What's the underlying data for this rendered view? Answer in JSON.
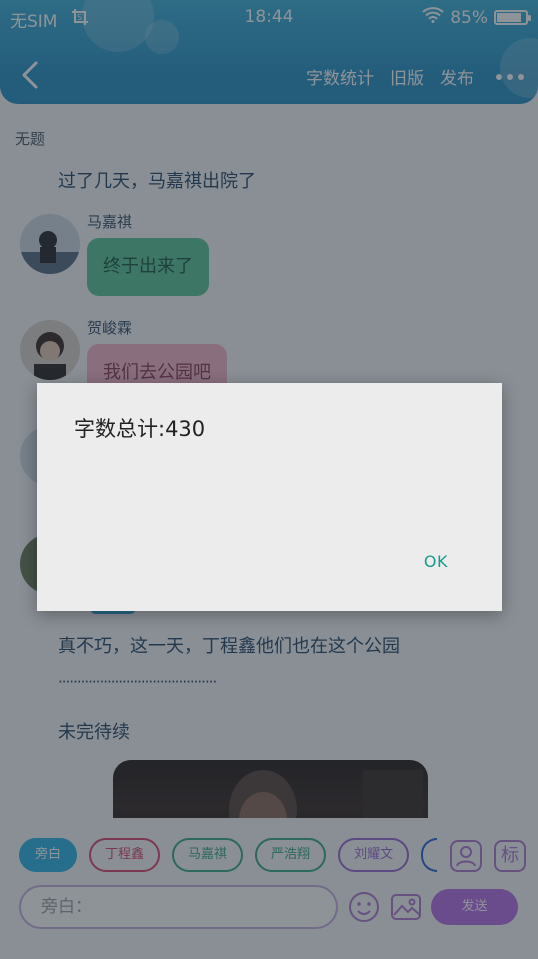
{
  "status_bar": {
    "carrier": "无SIM",
    "carrier_icon": "screenshot-icon",
    "time": "18:44",
    "battery_percent": "85%",
    "battery_level": 0.85,
    "wifi_icon": "wifi-icon"
  },
  "nav": {
    "back_icon": "chevron-left-icon",
    "actions": [
      "字数统计",
      "旧版",
      "发布"
    ],
    "more_icon": "more-dots-icon"
  },
  "story": {
    "title": "无题",
    "narration_1": "过了几天，马嘉祺出院了",
    "messages": [
      {
        "sender": "马嘉祺",
        "text": "终于出来了",
        "bubble_color": "#5fc49a",
        "text_color": "#1f5a44"
      },
      {
        "sender": "贺峻霖",
        "text": "我们去公园吧",
        "bubble_color": "#f5b4c8",
        "text_color": "#8a3c5a"
      }
    ],
    "narration_2": "真不巧，这一天，丁程鑫他们也在这个公园",
    "narration_3": "··········································",
    "narration_4": "未完待续"
  },
  "composer": {
    "chips": [
      {
        "label": "旁白",
        "color": "#2fb5e6",
        "active": true
      },
      {
        "label": "丁程鑫",
        "color": "#d8486e",
        "active": false
      },
      {
        "label": "马嘉祺",
        "color": "#3aa98a",
        "active": false
      },
      {
        "label": "严浩翔",
        "color": "#3aa98a",
        "active": false
      },
      {
        "label": "刘耀文",
        "color": "#9d6ad0",
        "active": false
      }
    ],
    "character_icon": "person-card-icon",
    "tag_label": "标",
    "input_placeholder": "旁白：",
    "emoji_icon": "smiley-icon",
    "image_icon": "image-icon",
    "send_label": "发送"
  },
  "dialog": {
    "message": "字数总计:430",
    "ok_label": "OK"
  }
}
